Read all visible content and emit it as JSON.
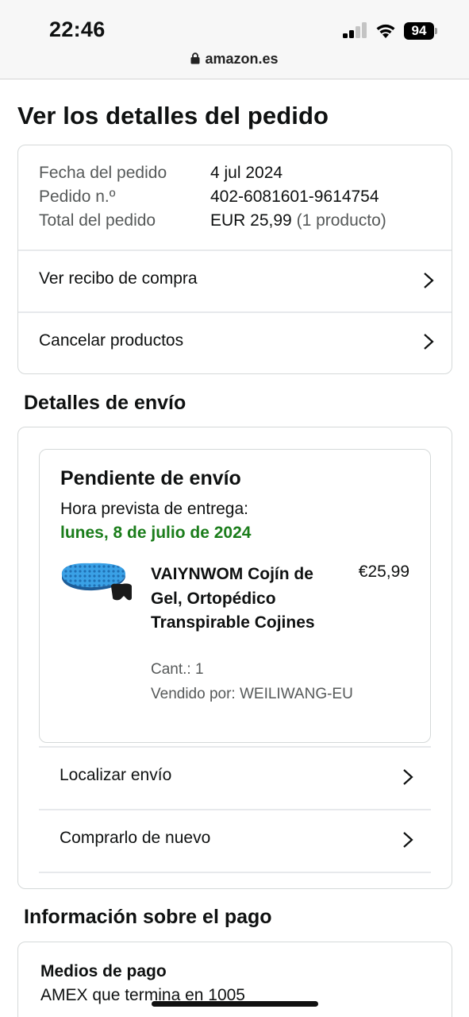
{
  "status_bar": {
    "time": "22:46",
    "battery": "94",
    "url": "amazon.es"
  },
  "page": {
    "title": "Ver los detalles del pedido"
  },
  "order_summary": {
    "rows": [
      {
        "label": "Fecha del pedido",
        "value": "4 jul 2024"
      },
      {
        "label": "Pedido n.º",
        "value": "402-6081601-9614754"
      },
      {
        "label": "Total del pedido",
        "value": "EUR 25,99",
        "extra": "(1 producto)"
      }
    ],
    "links": [
      {
        "label": "Ver recibo de compra"
      },
      {
        "label": "Cancelar productos"
      }
    ]
  },
  "shipping": {
    "section_title": "Detalles de envío",
    "status_title": "Pendiente de envío",
    "eta_label": "Hora prevista de entrega:",
    "eta_date": "lunes, 8 de julio de 2024",
    "product": {
      "name": "VAIYNWOM Cojín de Gel, Ortopédico Transpirable Cojines",
      "price": "€25,99",
      "quantity": "Cant.: 1",
      "seller": "Vendido por: WEILIWANG-EU"
    },
    "links": [
      {
        "label": "Localizar envío"
      },
      {
        "label": "Comprarlo de nuevo"
      }
    ]
  },
  "payment": {
    "section_title": "Información sobre el pago",
    "methods_title": "Medios de pago",
    "method_value": "AMEX  que termina en 1005"
  },
  "colors": {
    "eta_green": "#1b7d1b",
    "border": "#d5d9d9",
    "muted_text": "#565959"
  }
}
